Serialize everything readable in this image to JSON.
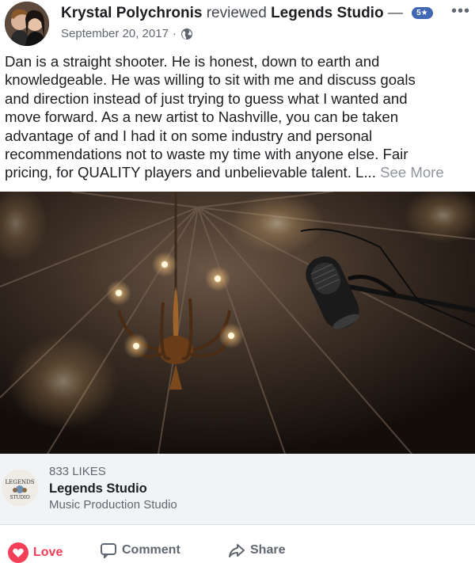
{
  "post": {
    "author": "Krystal Polychronis",
    "verb": "reviewed",
    "target": "Legends Studio",
    "separator": "—",
    "rating": "5★",
    "date": "September 20, 2017",
    "dot": "·",
    "privacy_icon": "globe-icon",
    "menu_icon": "more-icon"
  },
  "review": {
    "lines": [
      "Dan is a straight shooter. He is honest, down to earth and",
      "knowledgeable. He was willing to sit with me and discuss goals",
      "and direction instead of just trying to guess what I wanted and",
      "move forward. As a new artist to Nashville, you can be taken",
      "advantage of and I had it on some industry and personal",
      "recommendations not to waste my time with anyone else. Fair",
      "pricing, for QUALITY players and unbelievable talent. L..."
    ],
    "see_more": "See More"
  },
  "page": {
    "likes": "833 LIKES",
    "name": "Legends Studio",
    "category": "Music Production Studio",
    "logo_text": "LEGENDS STUDIO"
  },
  "actions": {
    "love": "Love",
    "comment": "Comment",
    "share": "Share"
  },
  "colors": {
    "accent": "#4267b2",
    "love": "#f33e58",
    "muted": "#606770",
    "bar": "#f2f3f5"
  }
}
